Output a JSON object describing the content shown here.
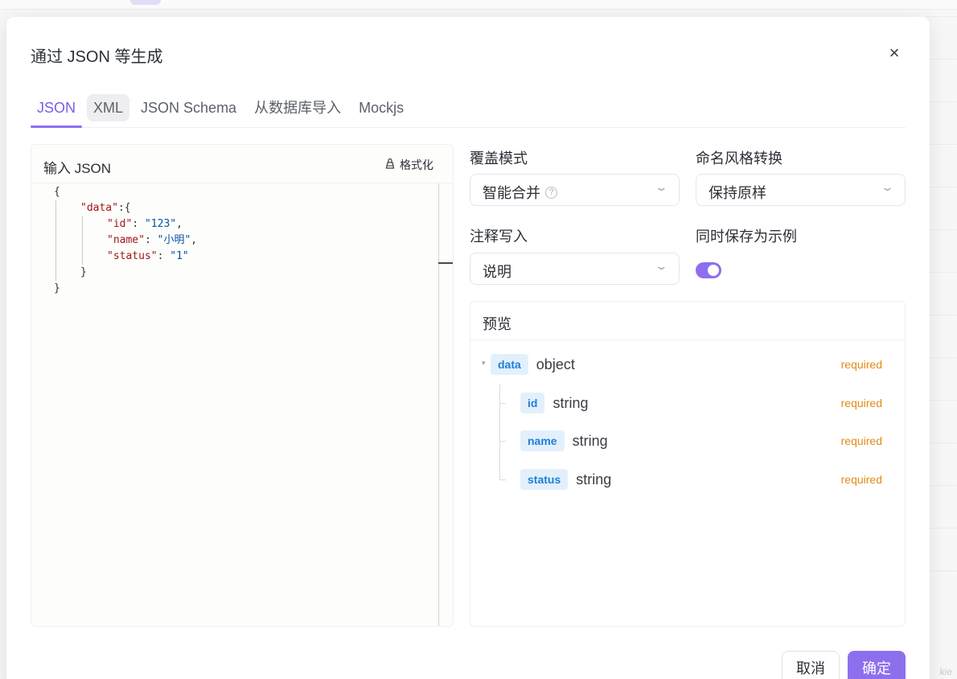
{
  "modal": {
    "title": "通过 JSON 等生成",
    "close_icon": "×"
  },
  "tabs": [
    {
      "label": "JSON",
      "active": true
    },
    {
      "label": "XML",
      "active": false
    },
    {
      "label": "JSON Schema",
      "active": false
    },
    {
      "label": "从数据库导入",
      "active": false
    },
    {
      "label": "Mockjs",
      "active": false
    }
  ],
  "editor": {
    "title": "输入 JSON",
    "format_label": "格式化",
    "code": {
      "open": "{",
      "data_key": "\"data\"",
      "data_open": ":{",
      "id_key": "\"id\"",
      "id_val": "\"123\"",
      "name_key": "\"name\"",
      "name_val": "\"小明\"",
      "status_key": "\"status\"",
      "status_val": "\"1\"",
      "inner_close": "}",
      "close": "}"
    }
  },
  "settings": {
    "overwrite_label": "覆盖模式",
    "overwrite_value": "智能合并",
    "naming_label": "命名风格转换",
    "naming_value": "保持原样",
    "comment_label": "注释写入",
    "comment_value": "说明",
    "save_example_label": "同时保存为示例",
    "save_example_on": true
  },
  "preview": {
    "title": "预览",
    "rows": [
      {
        "name": "data",
        "type": "object",
        "required": "required"
      },
      {
        "name": "id",
        "type": "string",
        "required": "required"
      },
      {
        "name": "name",
        "type": "string",
        "required": "required"
      },
      {
        "name": "status",
        "type": "string",
        "required": "required"
      }
    ]
  },
  "footer": {
    "cancel_label": "取消",
    "ok_label": "确定"
  },
  "colors": {
    "accent": "#8d6fee",
    "tag_bg": "#e3f0fc",
    "tag_text": "#1f7fd8",
    "required": "#e48a14"
  },
  "background": {
    "corner_text": "kie"
  }
}
